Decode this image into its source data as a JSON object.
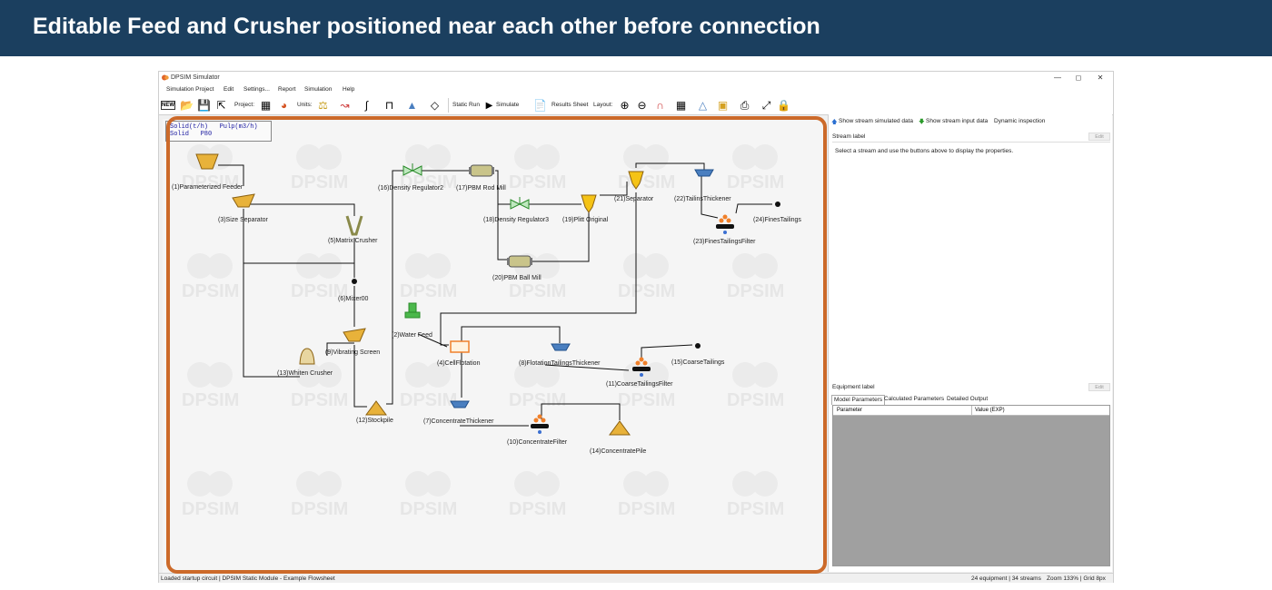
{
  "banner": {
    "title": "Editable Feed and Crusher positioned near each other before connection"
  },
  "window": {
    "title": "DPSIM Simulator",
    "min": "—",
    "max": "◻",
    "close": "✕"
  },
  "menu": [
    "Simulation Project",
    "Edit",
    "Settings...",
    "Report",
    "Simulation",
    "Help"
  ],
  "toolbar": {
    "new_label": "NEW",
    "project_label": "Project:",
    "units_label": "Units:",
    "static_run": "Static Run",
    "simulate": "Simulate",
    "results_sheet": "Results Sheet",
    "layout_label": "Layout:"
  },
  "legend": {
    "line1": "Solid(t/h)   Pulp(m3/h)",
    "line2": "Solid   P80"
  },
  "nodes": [
    {
      "label": "(1)Parameterized Feeder"
    },
    {
      "label": "(3)Size Separator"
    },
    {
      "label": "(5)Matrix Crusher"
    },
    {
      "label": "(6)Mixer00"
    },
    {
      "label": "(9)Vibrating Screen"
    },
    {
      "label": "(13)Whiten Crusher"
    },
    {
      "label": "(12)Stockpile"
    },
    {
      "label": "(16)Density Regulator2"
    },
    {
      "label": "(17)PBM Rod Mill"
    },
    {
      "label": "(18)Density Regulator3"
    },
    {
      "label": "(19)Plitt Original"
    },
    {
      "label": "(20)PBM Ball Mill"
    },
    {
      "label": "(21)Separator"
    },
    {
      "label": "(22)TailinsThickener"
    },
    {
      "label": "(24)FinesTailings"
    },
    {
      "label": "(23)FinesTailingsFilter"
    },
    {
      "label": "(2)Water Feed"
    },
    {
      "label": "(4)CellFlotation"
    },
    {
      "label": "(8)FlotationTailingsThickener"
    },
    {
      "label": "(15)CoarseTailings"
    },
    {
      "label": "(11)CoarseTailingsFilter"
    },
    {
      "label": "(7)ConcentrateThickener"
    },
    {
      "label": "(10)ConcentrateFilter"
    },
    {
      "label": "(14)ConcentratePile"
    }
  ],
  "right_panel": {
    "show_simulated": "Show stream simulated data",
    "show_input": "Show stream input data",
    "dynamic": "Dynamic inspection",
    "stream_label": "Stream label",
    "edit": "Edit",
    "hint": "Select a stream and use the buttons above to display the properties.",
    "equipment_label": "Equipment label",
    "tabs": [
      "Model Parameters",
      "Calculated Parameters",
      "Detailed Output"
    ],
    "col_parameter": "Parameter",
    "col_value": "Value (EXP)"
  },
  "status": {
    "left": "Loaded startup circuit | DPSIM Static Module - Example Flowsheet",
    "equipment": "24 equipment | 34 streams",
    "zoom": "Zoom 133% | Grid 8px"
  },
  "watermark": "DPSIM",
  "colors": {
    "banner": "#1b3f5f",
    "highlight": "#cc6a2a",
    "feeder": "#e8b23a",
    "valve": "#4cb84c",
    "thickener": "#4a7fc0"
  }
}
